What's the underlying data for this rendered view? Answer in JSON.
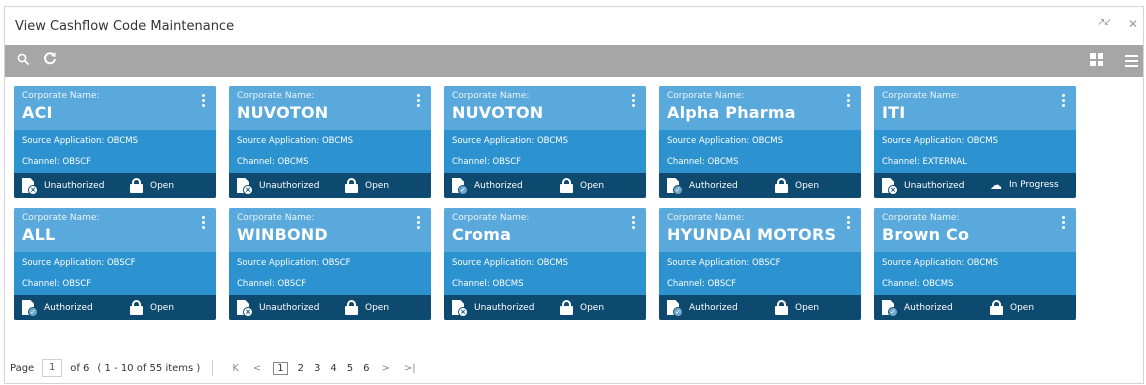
{
  "window": {
    "title": "View Cashflow Code Maintenance",
    "minimize_glyph": "↗↙",
    "close_glyph": "✕"
  },
  "toolbar": {
    "search_icon": "search-icon",
    "refresh_icon": "refresh-icon",
    "grid_icon": "grid-view-icon",
    "list_icon": "list-view-icon"
  },
  "cards": [
    {
      "label": "Corporate Name:",
      "name": "ACI",
      "source": "Source Application:  OBCMS",
      "channel": "Channel:  OBSCF",
      "auth": "Unauthorized",
      "status": "Open"
    },
    {
      "label": "Corporate Name:",
      "name": "NUVOTON",
      "source": "Source Application:  OBCMS",
      "channel": "Channel:  OBCMS",
      "auth": "Unauthorized",
      "status": "Open"
    },
    {
      "label": "Corporate Name:",
      "name": "NUVOTON",
      "source": "Source Application:  OBCMS",
      "channel": "Channel:  OBSCF",
      "auth": "Authorized",
      "status": "Open"
    },
    {
      "label": "Corporate Name:",
      "name": "Alpha Pharma",
      "source": "Source Application:  OBCMS",
      "channel": "Channel:  OBCMS",
      "auth": "Authorized",
      "status": "Open"
    },
    {
      "label": "Corporate Name:",
      "name": "ITI",
      "source": "Source Application:  OBCMS",
      "channel": "Channel:  EXTERNAL",
      "auth": "Unauthorized",
      "status": "In Progress"
    },
    {
      "label": "Corporate Name:",
      "name": "ALL",
      "source": "Source Application:  OBSCF",
      "channel": "Channel:  OBSCF",
      "auth": "Authorized",
      "status": "Open"
    },
    {
      "label": "Corporate Name:",
      "name": "WINBOND",
      "source": "Source Application:  OBSCF",
      "channel": "Channel:  OBSCF",
      "auth": "Unauthorized",
      "status": "Open"
    },
    {
      "label": "Corporate Name:",
      "name": "Croma",
      "source": "Source Application:  OBCMS",
      "channel": "Channel:  OBCMS",
      "auth": "Unauthorized",
      "status": "Open"
    },
    {
      "label": "Corporate Name:",
      "name": "HYUNDAI MOTORS",
      "source": "Source Application:  OBSCF",
      "channel": "Channel:  OBSCF",
      "auth": "Authorized",
      "status": "Open"
    },
    {
      "label": "Corporate Name:",
      "name": "Brown Co",
      "source": "Source Application:  OBCMS",
      "channel": "Channel:  OBCMS",
      "auth": "Authorized",
      "status": "Open"
    }
  ],
  "pager": {
    "page_label": "Page",
    "current_page": "1",
    "of_text": "of 6",
    "items_text": "( 1 - 10 of 55 items )",
    "first_glyph": "K",
    "prev_glyph": "<",
    "pages": [
      "1",
      "2",
      "3",
      "4",
      "5",
      "6"
    ],
    "next_glyph": ">",
    "last_glyph": ">|"
  }
}
